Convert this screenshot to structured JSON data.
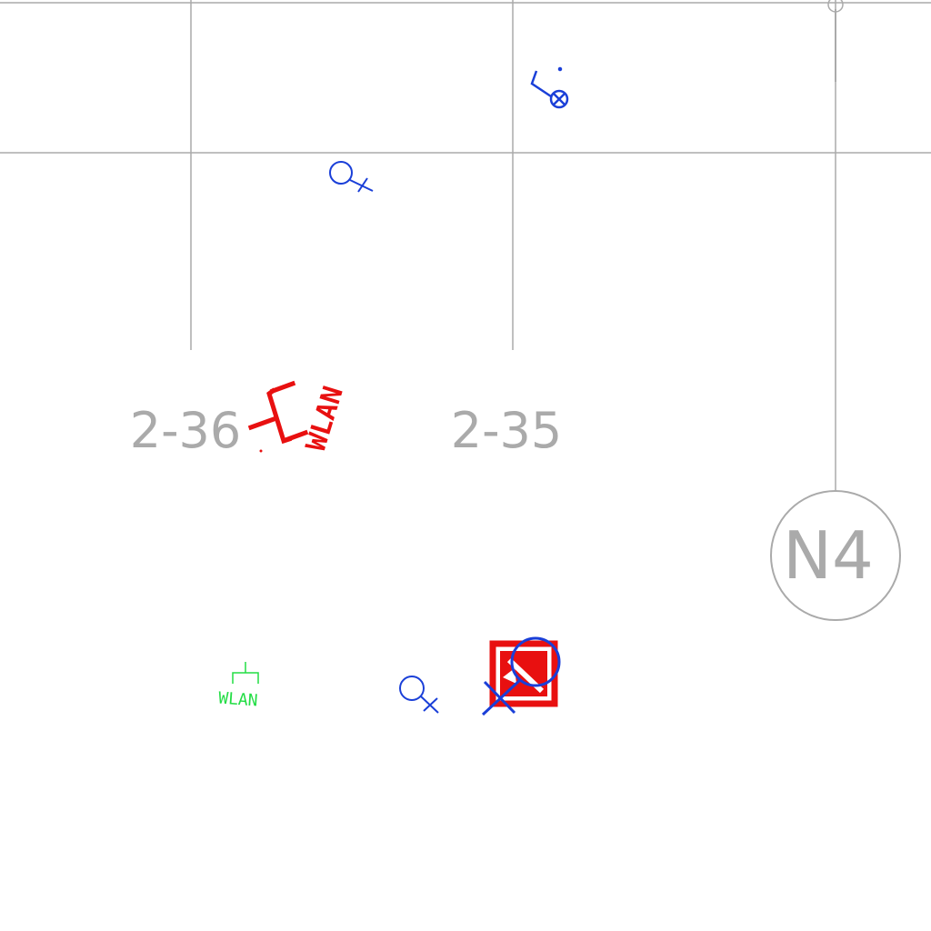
{
  "room_labels": {
    "left": "2-36",
    "right": "2-35"
  },
  "grid_marker": {
    "label": "N4"
  },
  "symbols": {
    "wlan_red_text": "WLAN",
    "wlan_green_text": "WLAN"
  },
  "colors": {
    "gridline": "#aaaaaa",
    "electrical_blue": "#1a3fd8",
    "wlan_red": "#e81010",
    "wlan_green": "#22dd44",
    "hazard_red": "#e81010"
  }
}
